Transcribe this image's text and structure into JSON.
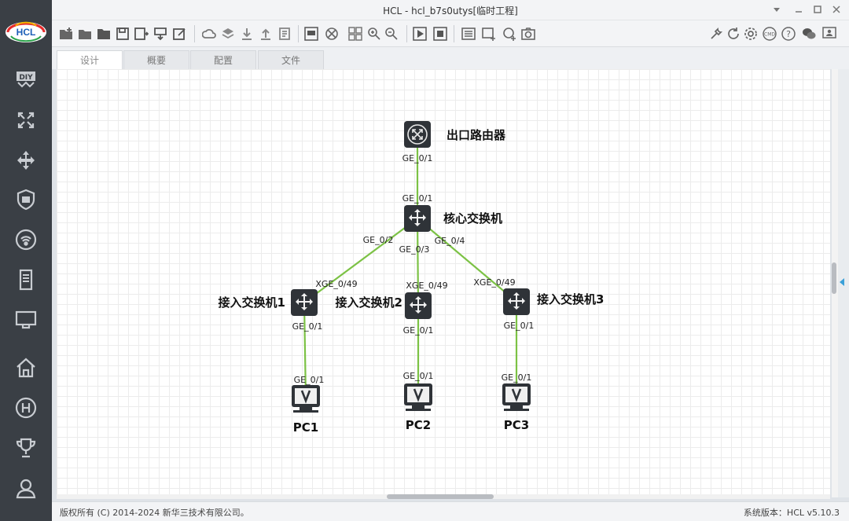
{
  "window": {
    "title": "HCL - hcl_b7s0utys[临时工程]"
  },
  "logo": {
    "text": "HCL"
  },
  "sidebar": {
    "items": [
      {
        "icon": "diy-icon"
      },
      {
        "icon": "router-icon"
      },
      {
        "icon": "switch-icon"
      },
      {
        "icon": "firewall-icon"
      },
      {
        "icon": "wireless-icon"
      },
      {
        "icon": "server-icon"
      },
      {
        "icon": "terminal-icon"
      },
      {
        "icon": "home-icon"
      },
      {
        "icon": "h3c-icon"
      },
      {
        "icon": "trophy-icon"
      },
      {
        "icon": "user-icon"
      }
    ]
  },
  "tabs": [
    {
      "label": "设计",
      "active": true
    },
    {
      "label": "概要",
      "active": false
    },
    {
      "label": "配置",
      "active": false
    },
    {
      "label": "文件",
      "active": false
    }
  ],
  "topology": {
    "nodes": [
      {
        "id": "r1",
        "label": "出口路由器",
        "type": "router"
      },
      {
        "id": "core",
        "label": "核心交换机",
        "type": "switch"
      },
      {
        "id": "acc1",
        "label": "接入交换机1",
        "type": "switch"
      },
      {
        "id": "acc2",
        "label": "接入交换机2",
        "type": "switch"
      },
      {
        "id": "acc3",
        "label": "接入交换机3",
        "type": "switch"
      },
      {
        "id": "pc1",
        "label": "PC1",
        "type": "pc"
      },
      {
        "id": "pc2",
        "label": "PC2",
        "type": "pc"
      },
      {
        "id": "pc3",
        "label": "PC3",
        "type": "pc"
      }
    ],
    "links": [
      {
        "from": "r1",
        "to": "core",
        "from_port": "GE_0/1",
        "to_port": "GE_0/1"
      },
      {
        "from": "core",
        "to": "acc1",
        "from_port": "GE_0/2",
        "to_port": "XGE_0/49"
      },
      {
        "from": "core",
        "to": "acc2",
        "from_port": "GE_0/3",
        "to_port": "XGE_0/49"
      },
      {
        "from": "core",
        "to": "acc3",
        "from_port": "GE_0/4",
        "to_port": "XGE_0/49"
      },
      {
        "from": "acc1",
        "to": "pc1",
        "from_port": "GE_0/1",
        "to_port": "GE_0/1"
      },
      {
        "from": "acc2",
        "to": "pc2",
        "from_port": "GE_0/1",
        "to_port": "GE_0/1"
      },
      {
        "from": "acc3",
        "to": "pc3",
        "from_port": "GE_0/1",
        "to_port": "GE_0/1"
      }
    ],
    "link_color": "#7cc245"
  },
  "statusbar": {
    "copyright": "版权所有 (C) 2014-2024 新华三技术有限公司。",
    "version": "系统版本：HCL v5.10.3"
  }
}
